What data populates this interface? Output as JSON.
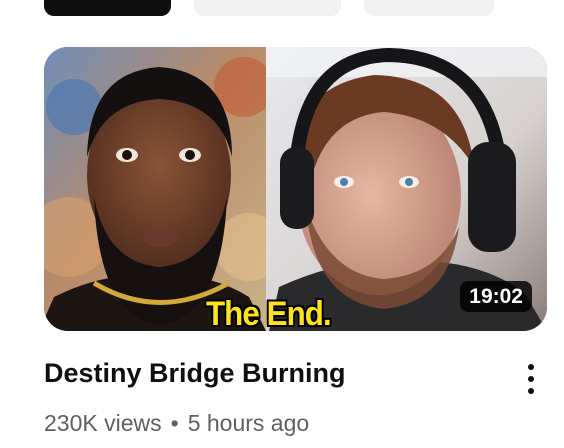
{
  "chips": [
    {
      "label": "",
      "active": true
    },
    {
      "label": "",
      "active": false
    },
    {
      "label": "",
      "active": false
    }
  ],
  "video": {
    "thumbnail_caption": "The End.",
    "duration": "19:02",
    "title": "Destiny Bridge Burning",
    "views": "230K views",
    "separator": "•",
    "age": "5 hours ago",
    "more_icon": "more-vert-icon"
  },
  "colors": {
    "caption_yellow": "#ffe31a",
    "duration_bg": "#000000",
    "meta_gray": "#606060",
    "title_black": "#0f0f0f"
  }
}
